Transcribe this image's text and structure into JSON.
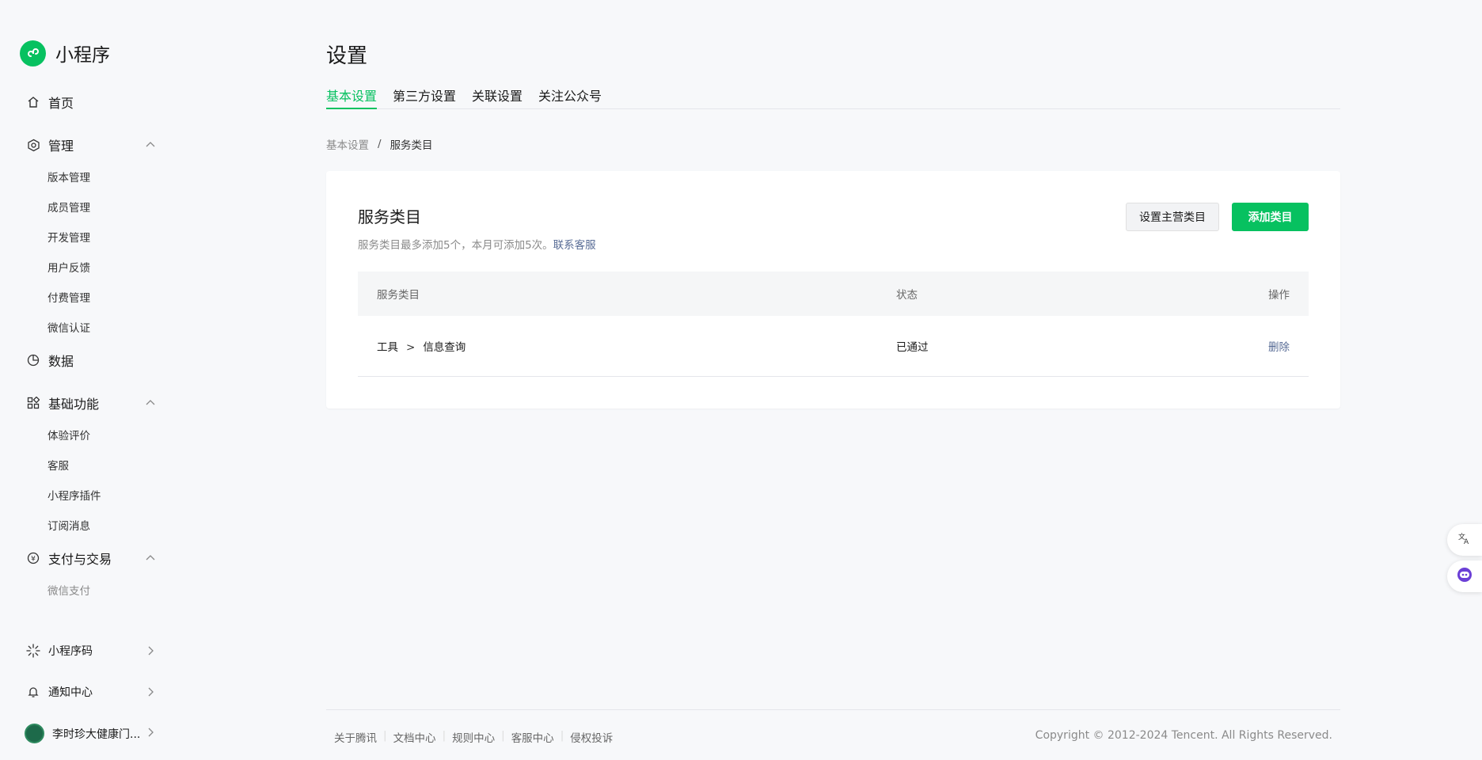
{
  "brand": {
    "name": "小程序"
  },
  "sidebar": {
    "home": "首页",
    "manage": {
      "label": "管理",
      "items": [
        "版本管理",
        "成员管理",
        "开发管理",
        "用户反馈",
        "付费管理",
        "微信认证"
      ]
    },
    "data": "数据",
    "basic": {
      "label": "基础功能",
      "items": [
        "体验评价",
        "客服",
        "小程序插件",
        "订阅消息"
      ]
    },
    "pay": {
      "label": "支付与交易",
      "items": [
        "微信支付"
      ]
    },
    "qrcode": "小程序码",
    "notify": "通知中心",
    "user": "李时珍大健康门..."
  },
  "page": {
    "title": "设置",
    "tabs": [
      "基本设置",
      "第三方设置",
      "关联设置",
      "关注公众号"
    ],
    "breadcrumb": {
      "parent": "基本设置",
      "separator": "/",
      "current": "服务类目"
    }
  },
  "card": {
    "title": "服务类目",
    "desc": "服务类目最多添加5个，本月可添加5次。",
    "contact_link": "联系客服",
    "btn_set_main": "设置主营类目",
    "btn_add": "添加类目",
    "table": {
      "headers": {
        "category": "服务类目",
        "status": "状态",
        "op": "操作"
      },
      "rows": [
        {
          "cat1": "工具",
          "sep": ">",
          "cat2": "信息查询",
          "status": "已通过",
          "op": "删除"
        }
      ]
    }
  },
  "footer": {
    "links": [
      "关于腾讯",
      "文档中心",
      "规则中心",
      "客服中心",
      "侵权投诉"
    ],
    "copyright": "Copyright © 2012-2024 Tencent. All Rights Reserved."
  },
  "colors": {
    "accent": "#07c160",
    "link": "#576b95",
    "background": "#f7f8fa"
  },
  "icons": [
    "miniprogram-logo-icon",
    "home-icon",
    "manage-icon",
    "data-icon",
    "basic-function-icon",
    "payment-icon",
    "qrcode-icon",
    "bell-icon",
    "chevron-up-icon",
    "chevron-right-icon",
    "translate-icon",
    "assistant-icon"
  ]
}
